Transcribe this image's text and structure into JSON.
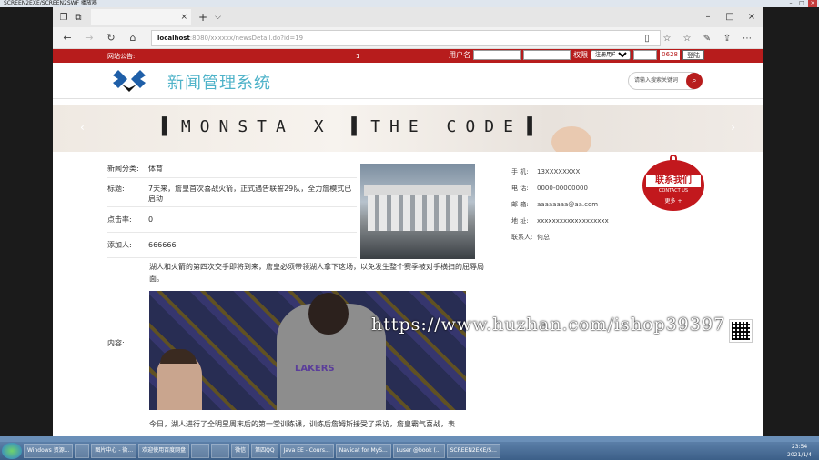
{
  "player": {
    "title": "SCREEN2EXE/SCREEN2SWF 播放器",
    "min": "–",
    "max": "□",
    "close": "×"
  },
  "browser": {
    "tab_title": "",
    "new_tab": "+",
    "tab_dropdown": "⌵",
    "win_min": "–",
    "win_max": "□",
    "win_close": "×",
    "address_host": "localhost",
    "address_path": ":8080/xxxxxx/newsDetail.do?id=19",
    "info_icon": "ⓘ"
  },
  "topbar": {
    "notice_label": "网站公告:",
    "mid_text": "1",
    "username_label": "用户名",
    "password_label": "密码",
    "role_label": "权限",
    "role_selected": "注册用户",
    "captcha_code": "0628",
    "login_button": "登陆"
  },
  "header": {
    "site_title": "新闻管理系统",
    "search_placeholder": "请输入搜索关键词"
  },
  "banner": {
    "text": "▌MONSTA X ▌THE CODE▐",
    "prev": "‹",
    "next": "›"
  },
  "article": {
    "category_label": "新闻分类:",
    "category_value": "体育",
    "title_label": "标题:",
    "title_value": "7天来，詹皇首次喜战火箭，正式遇告联誓29队，全力詹模式已启动",
    "clicks_label": "点击率:",
    "clicks_value": "0",
    "added_by_label": "添加人:",
    "added_by_value": "666666",
    "content_label": "内容:",
    "content_intro": "湖人和火箭的第四次交手即将到来，詹皇必须带领湖人拿下这场，以免发生整个赛季被对手横扫的屈辱局面。",
    "jersey_text": "LAKERS",
    "content_bottom": "今日，湖人进行了全明星周末后的第一堂训练课，训练后詹姆斯接受了采访，詹皇霸气喜战，表"
  },
  "contact": {
    "items": [
      {
        "k": "手   机:",
        "v": "13XXXXXXXX"
      },
      {
        "k": "电   话:",
        "v": "0000-00000000"
      },
      {
        "k": "邮   箱:",
        "v": "aaaaaaaa@aa.com"
      },
      {
        "k": "地   址:",
        "v": "xxxxxxxxxxxxxxxxxxx"
      },
      {
        "k": "联系人:",
        "v": "何总"
      }
    ],
    "badge_title": "联系我们",
    "badge_en": "CONTACT US",
    "badge_more": "更多 +"
  },
  "watermark": "https://www.huzhan.com/ishop39397",
  "taskbar": {
    "items": [
      "Windows 资源...",
      "",
      "图片中心 - 微...",
      "欢迎使用百度网盘",
      "",
      "",
      "微信",
      "第四QQ",
      "Java EE - Cours...",
      "Navicat for MyS...",
      "Luser @book (...",
      "SCREEN2EXE/S..."
    ],
    "time": "23:54",
    "date": "2021/1/4"
  },
  "colors": {
    "accent_red": "#b71c1c",
    "title_teal": "#4fb3c9"
  }
}
